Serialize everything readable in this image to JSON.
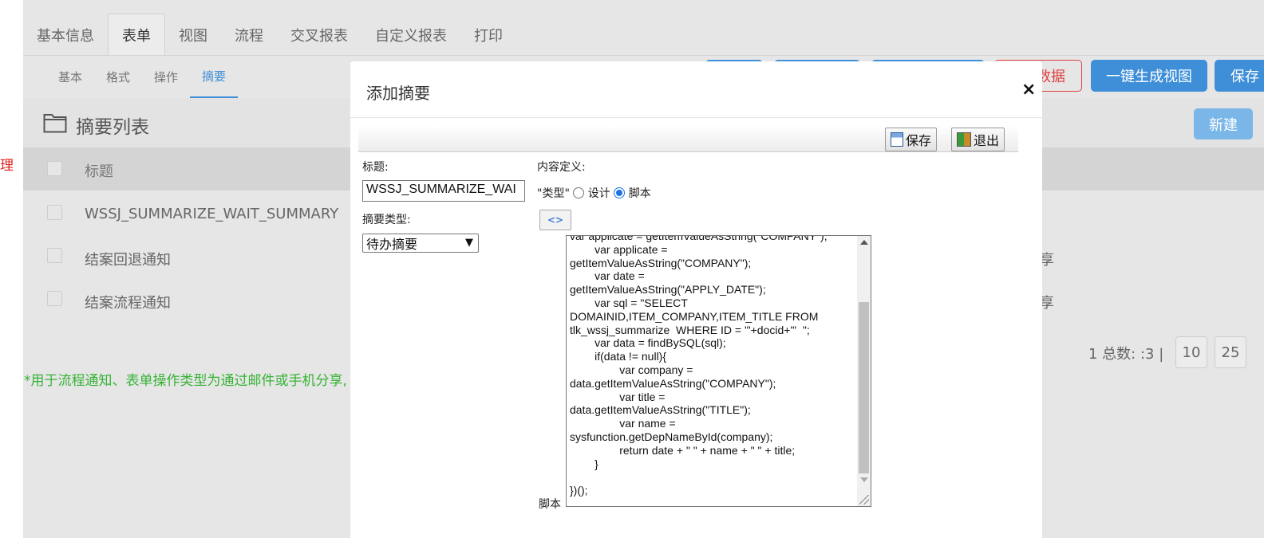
{
  "left_label": "理",
  "top_tabs": [
    "基本信息",
    "表单",
    "视图",
    "流程",
    "交叉报表",
    "自定义报表",
    "打印"
  ],
  "sub_tabs": [
    "基本",
    "格式",
    "操作",
    "摘要"
  ],
  "action_bar": {
    "delete_data_label": "数据",
    "generate_view_label": "一键生成视图",
    "save_label": "保存"
  },
  "list": {
    "title": "摘要列表",
    "new_label": "新建",
    "column_title": "标题",
    "rows": [
      {
        "title": "WSSJ_SUMMARIZE_WAIT_SUMMARY",
        "right": ""
      },
      {
        "title": "结案回退通知",
        "right": "享"
      },
      {
        "title": "结案流程通知",
        "right": "享"
      }
    ],
    "pager_text": "1  总数: :3  |",
    "page_sizes": [
      "10",
      "25"
    ],
    "note": "*用于流程通知、表单操作类型为通过邮件或手机分享,"
  },
  "modal": {
    "title": "添加摘要",
    "close": "×",
    "save_btn": "保存",
    "exit_btn": "退出",
    "title_label": "标题:",
    "title_value": "WSSJ_SUMMARIZE_WAI",
    "type_label": "摘要类型:",
    "type_value": "待办摘要",
    "content_label": "内容定义:",
    "kind_label": "\"类型\"",
    "radio_design": "设计",
    "radio_script": "脚本",
    "script_label": "脚本",
    "script_icon": "code-icon",
    "code": "var applicate = getItemValueAsString(\"COMPANY\");\n        var applicate =\ngetItemValueAsString(\"COMPANY\");\n        var date =\ngetItemValueAsString(\"APPLY_DATE\");\n        var sql = \"SELECT\nDOMAINID,ITEM_COMPANY,ITEM_TITLE FROM\ntlk_wssj_summarize  WHERE ID = '\"+docid+\"'  \";\n        var data = findBySQL(sql);\n        if(data != null){\n                var company =\ndata.getItemValueAsString(\"COMPANY\");\n                var title =\ndata.getItemValueAsString(\"TITLE\");\n                var name =\nsysfunction.getDepNameById(company);\n                return date + \" \" + name + \" \" + title;\n        }\n\n})();"
  }
}
